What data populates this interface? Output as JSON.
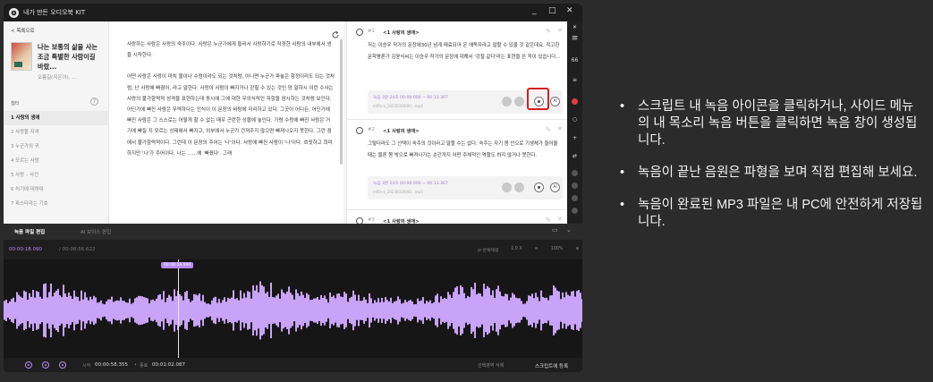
{
  "window": {
    "title": "내가 만든 오디오북 KIT"
  },
  "sidebar": {
    "back_label": "< 목록으로",
    "book_title": "나는 보통의 삶을 사는 조금 특별한 사람이길 바랐...",
    "book_author": "오름길(지은이), ...",
    "toc_header": "챕터",
    "help": "?",
    "items": [
      {
        "label": "1 사랑의 생애"
      },
      {
        "label": "2 사랑할 자격"
      },
      {
        "label": "3 누군가의 귀"
      },
      {
        "label": "4 모르는 사람"
      },
      {
        "label": "5 사랑 – 사건"
      },
      {
        "label": "6 허기에 대하여"
      },
      {
        "label": "7 파스타라는 기호"
      }
    ]
  },
  "editor": {
    "para1": "사랑하는 사람은 사랑의 숙주이다. 사랑은 누군가에게 들러서 사랑하기로 작정한 사람의 내부에서 생을 시작한다.",
    "para2": "어떤 사람은 사랑이 마치 물이나 수렁이라도 되는 것처럼, 아니면 누군가 파놓은 함정이라도 되는 것처럼, 난 사랑에 빠졌어, 라고 말한다. 사랑이 사람이 빠지거나 갇힐 수 있는 것인 양 말하시 이런 수사는 사랑의 불가항력적 성격을 표현하는데 동시에 그에 대한 무의식적인 저항을 암시하는 것처럼 보인다. 어딘가에 빠진 사람은 무력하다는 인식이 이 문장의 바탕에 자리하고 있다. 그곳이 어디든, 어딘가에 빠진 사람은 그 스스로는 어떻게 할 수 없는 매우 곤란한 상황에 놓인다. 가령 수렁에 빠진 사람은 거기에 빠질 지 모르는 상태에서 빠지고, 외부에서 누군가 건져주지 않으면 빠져나오지 못한다. 그런 점에서 불가항력적이다. 그런데 이 문장의 주어는 '나'이다. 사랑에 빠진 사람이 '나'이다. 흐릿하고 희미하지만 '나'가 주어이다. 나는 ……에 '빠졌다'. 그래"
  },
  "memo": {
    "cards": [
      {
        "num": "#1",
        "chapter": "<1 사랑의 생애>",
        "text": "저는 이승우 작가의 문장에30년 넘게 매료되어 온 애독자라고 말할 수 있을 것 같은데요. 작고한 문학평론가 김윤식씨는 이승우 작가의 문장에 대해서 '강철 같다'라는 표현을 쓴 적이 있습니다...",
        "rec_label": "녹음  3분 24초  00:00:000 ~ 00:13.367",
        "rec_file": "mf0s-a_20230320(00...mp3"
      },
      {
        "num": "#2",
        "chapter": "<1 사랑의 생애>",
        "text": "그렇더라도 그 선택이 숙주의 것이라고 말할 수는 없다. 숙주는 자기 몸 안으로 기생체가 들어올 때는 물론 몸 밖으로 빠져나가는 순간까지 어떤 주체적인 역할도 하지 않거나 못한다.",
        "rec_label": "녹음  3분 24초  00:00:000 ~ 00:13.367",
        "rec_file": "mf0s-a_20230320(00...mp3"
      },
      {
        "num": "#3",
        "chapter": "<1 사랑의 생애>"
      }
    ],
    "ai_label": "AI"
  },
  "audio": {
    "tab_edit": "녹음 파일 편집",
    "tab_ai": "AI 보이스 편집",
    "current_time": "00:00:18.090",
    "total_time": "/ 00:08:56.622",
    "tool_repeat": "⇄ 반복재생",
    "tool_speed": "1.0 X",
    "tool_zoom": "100%",
    "playhead_label": "00:00:18.090",
    "sel_start_label": "시작",
    "sel_start": "00:00:58.355",
    "sel_end_label": "종료",
    "sel_end": "00:01:02.087",
    "delete_label": "선택영역 삭제",
    "register_label": "스크립트에 등록"
  },
  "notes": [
    "스크립트 내 녹음 아이콘을 클릭하거나, 사이드 메뉴의 내 목소리 녹음 버튼을 클릭하면 녹음 창이 생성됩니다.",
    "녹음이 끝난 음원은 파형을 보며 직접 편집해 보세요.",
    "녹음이 완료된 MP3 파일은 내 PC에 안전하게 저장됩니다."
  ],
  "colors": {
    "accent": "#b78cf0",
    "highlight": "#d21f1f",
    "waveform": "#c9a3f7"
  }
}
